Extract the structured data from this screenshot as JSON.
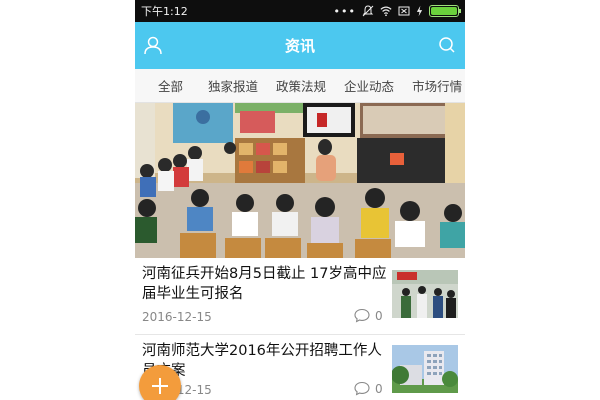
{
  "status_bar": {
    "time": "下午1:12",
    "icons": [
      "signal-dots-icon",
      "mute-icon",
      "wifi-icon",
      "sim-icon",
      "charging-icon",
      "battery-icon"
    ],
    "battery_level": 1.0
  },
  "header": {
    "title": "资讯",
    "left_icon": "user-icon",
    "right_icon": "search-icon",
    "color": "#4cc8ef"
  },
  "tabs": [
    "全部",
    "独家报道",
    "政策法规",
    "企业动态",
    "市场行情"
  ],
  "news": [
    {
      "title": "河南征兵开始8月5日截止 17岁高中应届毕业生可报名",
      "date": "2016-12-15",
      "comments": "0"
    },
    {
      "title": "河南师范大学2016年公开招聘工作人员方案",
      "date": "2016-12-15",
      "comments": "0"
    }
  ],
  "fab": {
    "icon": "plus-icon",
    "color": "#f39c3c"
  }
}
